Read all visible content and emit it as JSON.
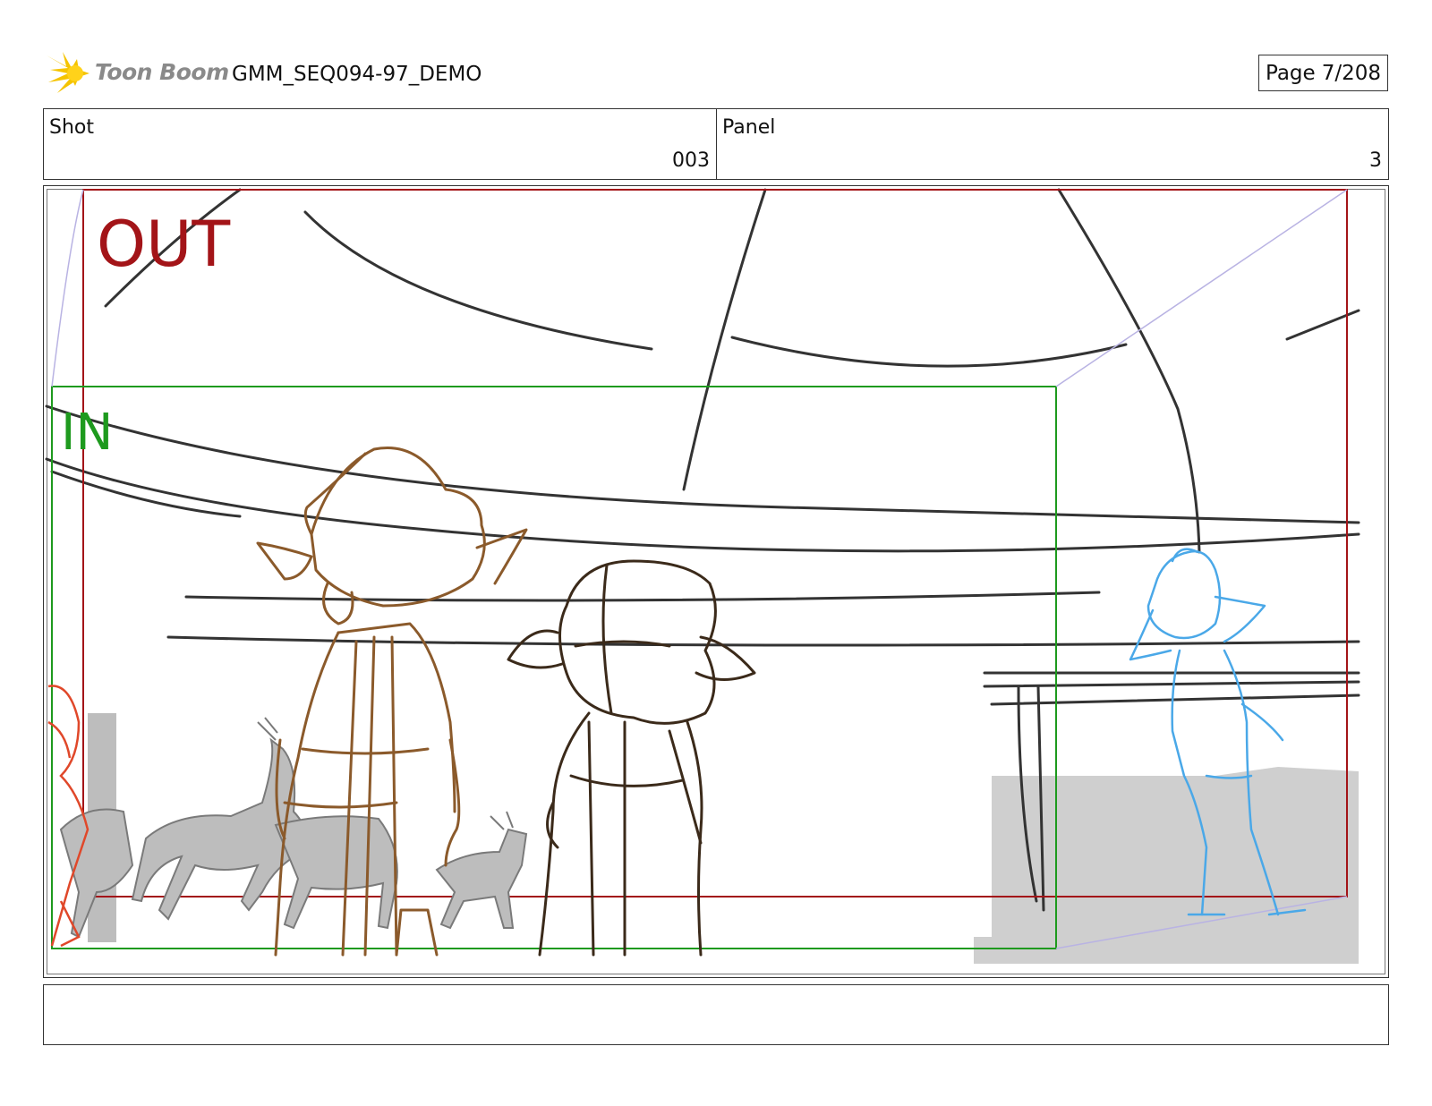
{
  "header": {
    "logo_text": "Toon Boom",
    "title": "GMM_SEQ094-97_DEMO",
    "page_label": "Page",
    "page_value": "7/208"
  },
  "info": {
    "shot_label": "Shot",
    "shot_value": "003",
    "panel_label": "Panel",
    "panel_value": "3"
  },
  "frame": {
    "out_label": "OUT",
    "in_label": "IN",
    "colors": {
      "out": "#a31418",
      "in": "#1e9a1e",
      "character_brown": "#8b5a2b",
      "character_dark": "#3b2a1a",
      "character_blue": "#4aa8e8",
      "character_red": "#e0482a",
      "background_gray": "#c8c8c8"
    }
  },
  "notes": {
    "text": ""
  }
}
